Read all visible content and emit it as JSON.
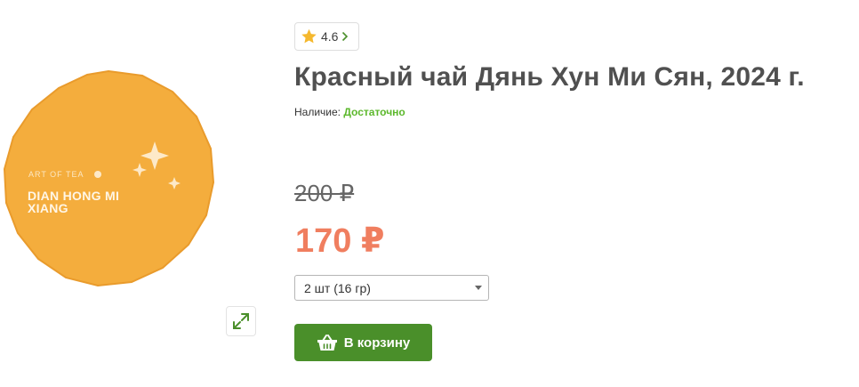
{
  "product": {
    "title": "Красный чай Дянь Хун Ми Сян, 2024 г.",
    "rating": "4.6",
    "availability_label": "Наличие:",
    "availability_value": "Достаточно",
    "old_price": "200 ₽",
    "price": "170 ₽",
    "package_brand": "ART OF TEA",
    "package_name": "DIAN HONG MI XIANG"
  },
  "quantity": {
    "selected": "2 шт (16 гр)"
  },
  "cart": {
    "button_label": "В корзину"
  },
  "colors": {
    "accent_green": "#4a8f2a",
    "stock_green": "#5cb82c",
    "price_orange": "#f07e5f",
    "star_yellow": "#f5b82e",
    "package_orange": "#f4ad3d"
  },
  "icons": {
    "rating": "star-icon",
    "rating_more": "chevron-right-icon",
    "expand": "expand-icon",
    "cart": "basket-icon",
    "select": "chevron-down-icon"
  }
}
